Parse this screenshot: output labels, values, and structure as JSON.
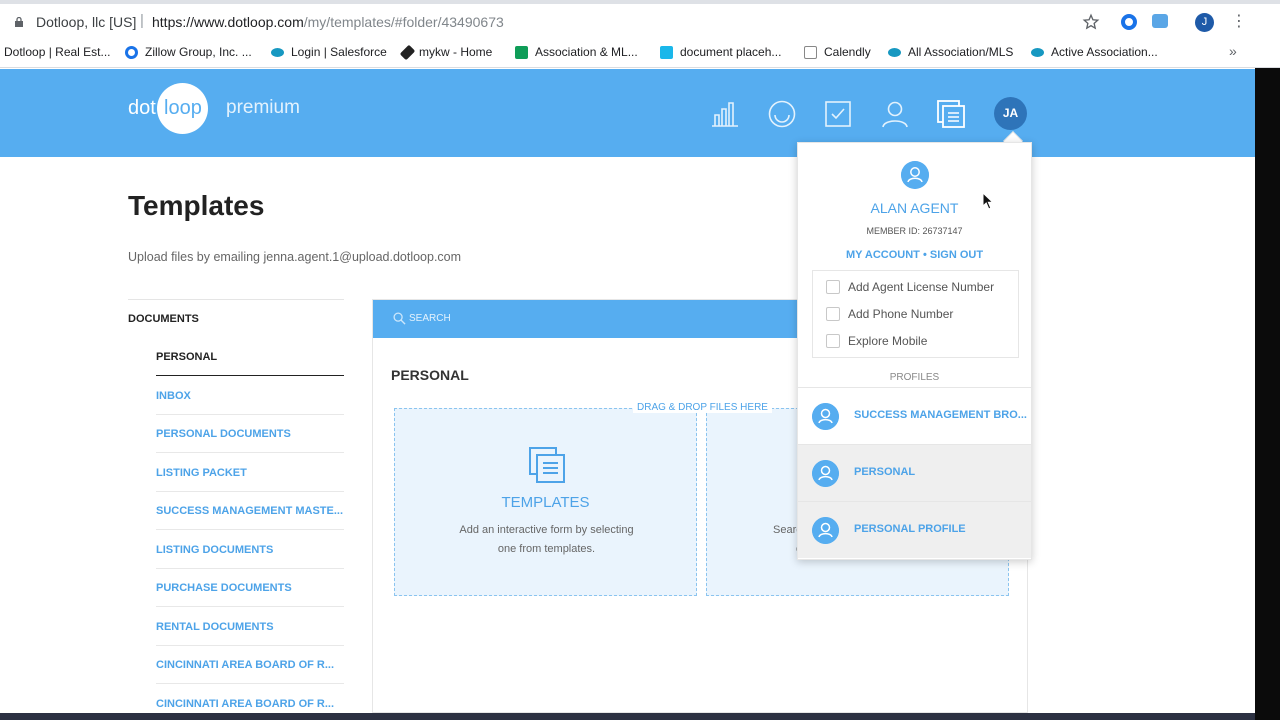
{
  "browser": {
    "site_name": "Dotloop, llc [US]",
    "url_host": "https://www.dotloop.com",
    "url_path": "/my/templates/#folder/43490673",
    "profile_initial": "J",
    "more": "⋮"
  },
  "bookmarks": [
    {
      "label": "Dotloop | Real Est...",
      "color": "#ffffff"
    },
    {
      "label": "Zillow Group, Inc. ...",
      "color": "#1a73e8"
    },
    {
      "label": "Login | Salesforce",
      "color": "#1798c1"
    },
    {
      "label": "mykw - Home",
      "color": "#222222"
    },
    {
      "label": "Association & ML...",
      "color": "#0f9d58"
    },
    {
      "label": "document placeh...",
      "color": "#1ab7ea"
    },
    {
      "label": "Calendly",
      "color": "#888888"
    },
    {
      "label": "All Association/MLS",
      "color": "#1798c1"
    },
    {
      "label": "Active Association...",
      "color": "#1798c1"
    }
  ],
  "bookmarks_more": "»",
  "header": {
    "logo_dot": "dot",
    "logo_loop": "loop",
    "logo_product": "premium",
    "avatar_initials": "JA"
  },
  "page": {
    "title": "Templates",
    "upload_hint": "Upload files by emailing jenna.agent.1@upload.dotloop.com"
  },
  "sidebar": {
    "heading": "DOCUMENTS",
    "items": [
      {
        "label": "PERSONAL"
      },
      {
        "label": "INBOX"
      },
      {
        "label": "PERSONAL DOCUMENTS"
      },
      {
        "label": "LISTING PACKET"
      },
      {
        "label": "SUCCESS MANAGEMENT MASTE..."
      },
      {
        "label": "LISTING DOCUMENTS"
      },
      {
        "label": "PURCHASE DOCUMENTS"
      },
      {
        "label": "RENTAL DOCUMENTS"
      },
      {
        "label": "CINCINNATI AREA BOARD OF R..."
      },
      {
        "label": "CINCINNATI AREA BOARD OF R..."
      }
    ]
  },
  "main": {
    "search_placeholder": "SEARCH",
    "section_title": "PERSONAL",
    "dropzone_label": "DRAG & DROP FILES HERE",
    "templates_card": {
      "title": "TEMPLATES",
      "desc_line1": "Add an interactive form by selecting",
      "desc_line2": "one from templates."
    },
    "right_card": {
      "desc_line1": "Searc",
      "desc_line2": "c"
    }
  },
  "account_menu": {
    "name": "ALAN AGENT",
    "member_id": "MEMBER ID: 26737147",
    "my_account": "MY ACCOUNT",
    "separator": "•",
    "sign_out": "SIGN OUT",
    "checklist": [
      {
        "label": "Add Agent License Number",
        "checked": false
      },
      {
        "label": "Add Phone Number",
        "checked": false
      },
      {
        "label": "Explore Mobile",
        "checked": false
      }
    ],
    "profiles_label": "PROFILES",
    "profiles": [
      {
        "label": "SUCCESS MANAGEMENT BRO...",
        "selected": false
      },
      {
        "label": "PERSONAL",
        "selected": true
      },
      {
        "label": "PERSONAL PROFILE",
        "selected": true
      }
    ]
  },
  "colors": {
    "brand_blue": "#56adf0",
    "link_blue": "#4da3e8"
  }
}
